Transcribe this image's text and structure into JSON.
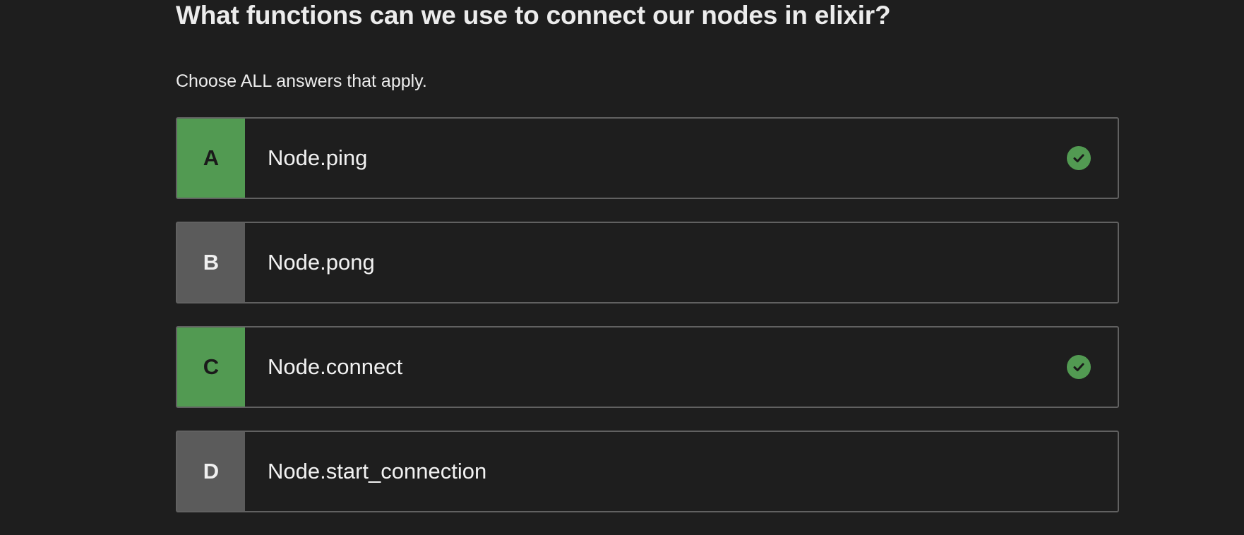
{
  "question": {
    "title": "What functions can we use to connect our nodes in elixir?",
    "instructions": "Choose ALL answers that apply."
  },
  "answers": [
    {
      "letter": "A",
      "text": "Node.ping",
      "selected": true,
      "icon": "check-circle-icon"
    },
    {
      "letter": "B",
      "text": "Node.pong",
      "selected": false
    },
    {
      "letter": "C",
      "text": "Node.connect",
      "selected": true,
      "icon": "check-circle-icon"
    },
    {
      "letter": "D",
      "text": "Node.start_connection",
      "selected": false
    }
  ],
  "colors": {
    "background": "#1e1e1e",
    "selected_accent": "#529a52",
    "unselected_letter_bg": "#5b5b5b",
    "border": "#616161"
  }
}
